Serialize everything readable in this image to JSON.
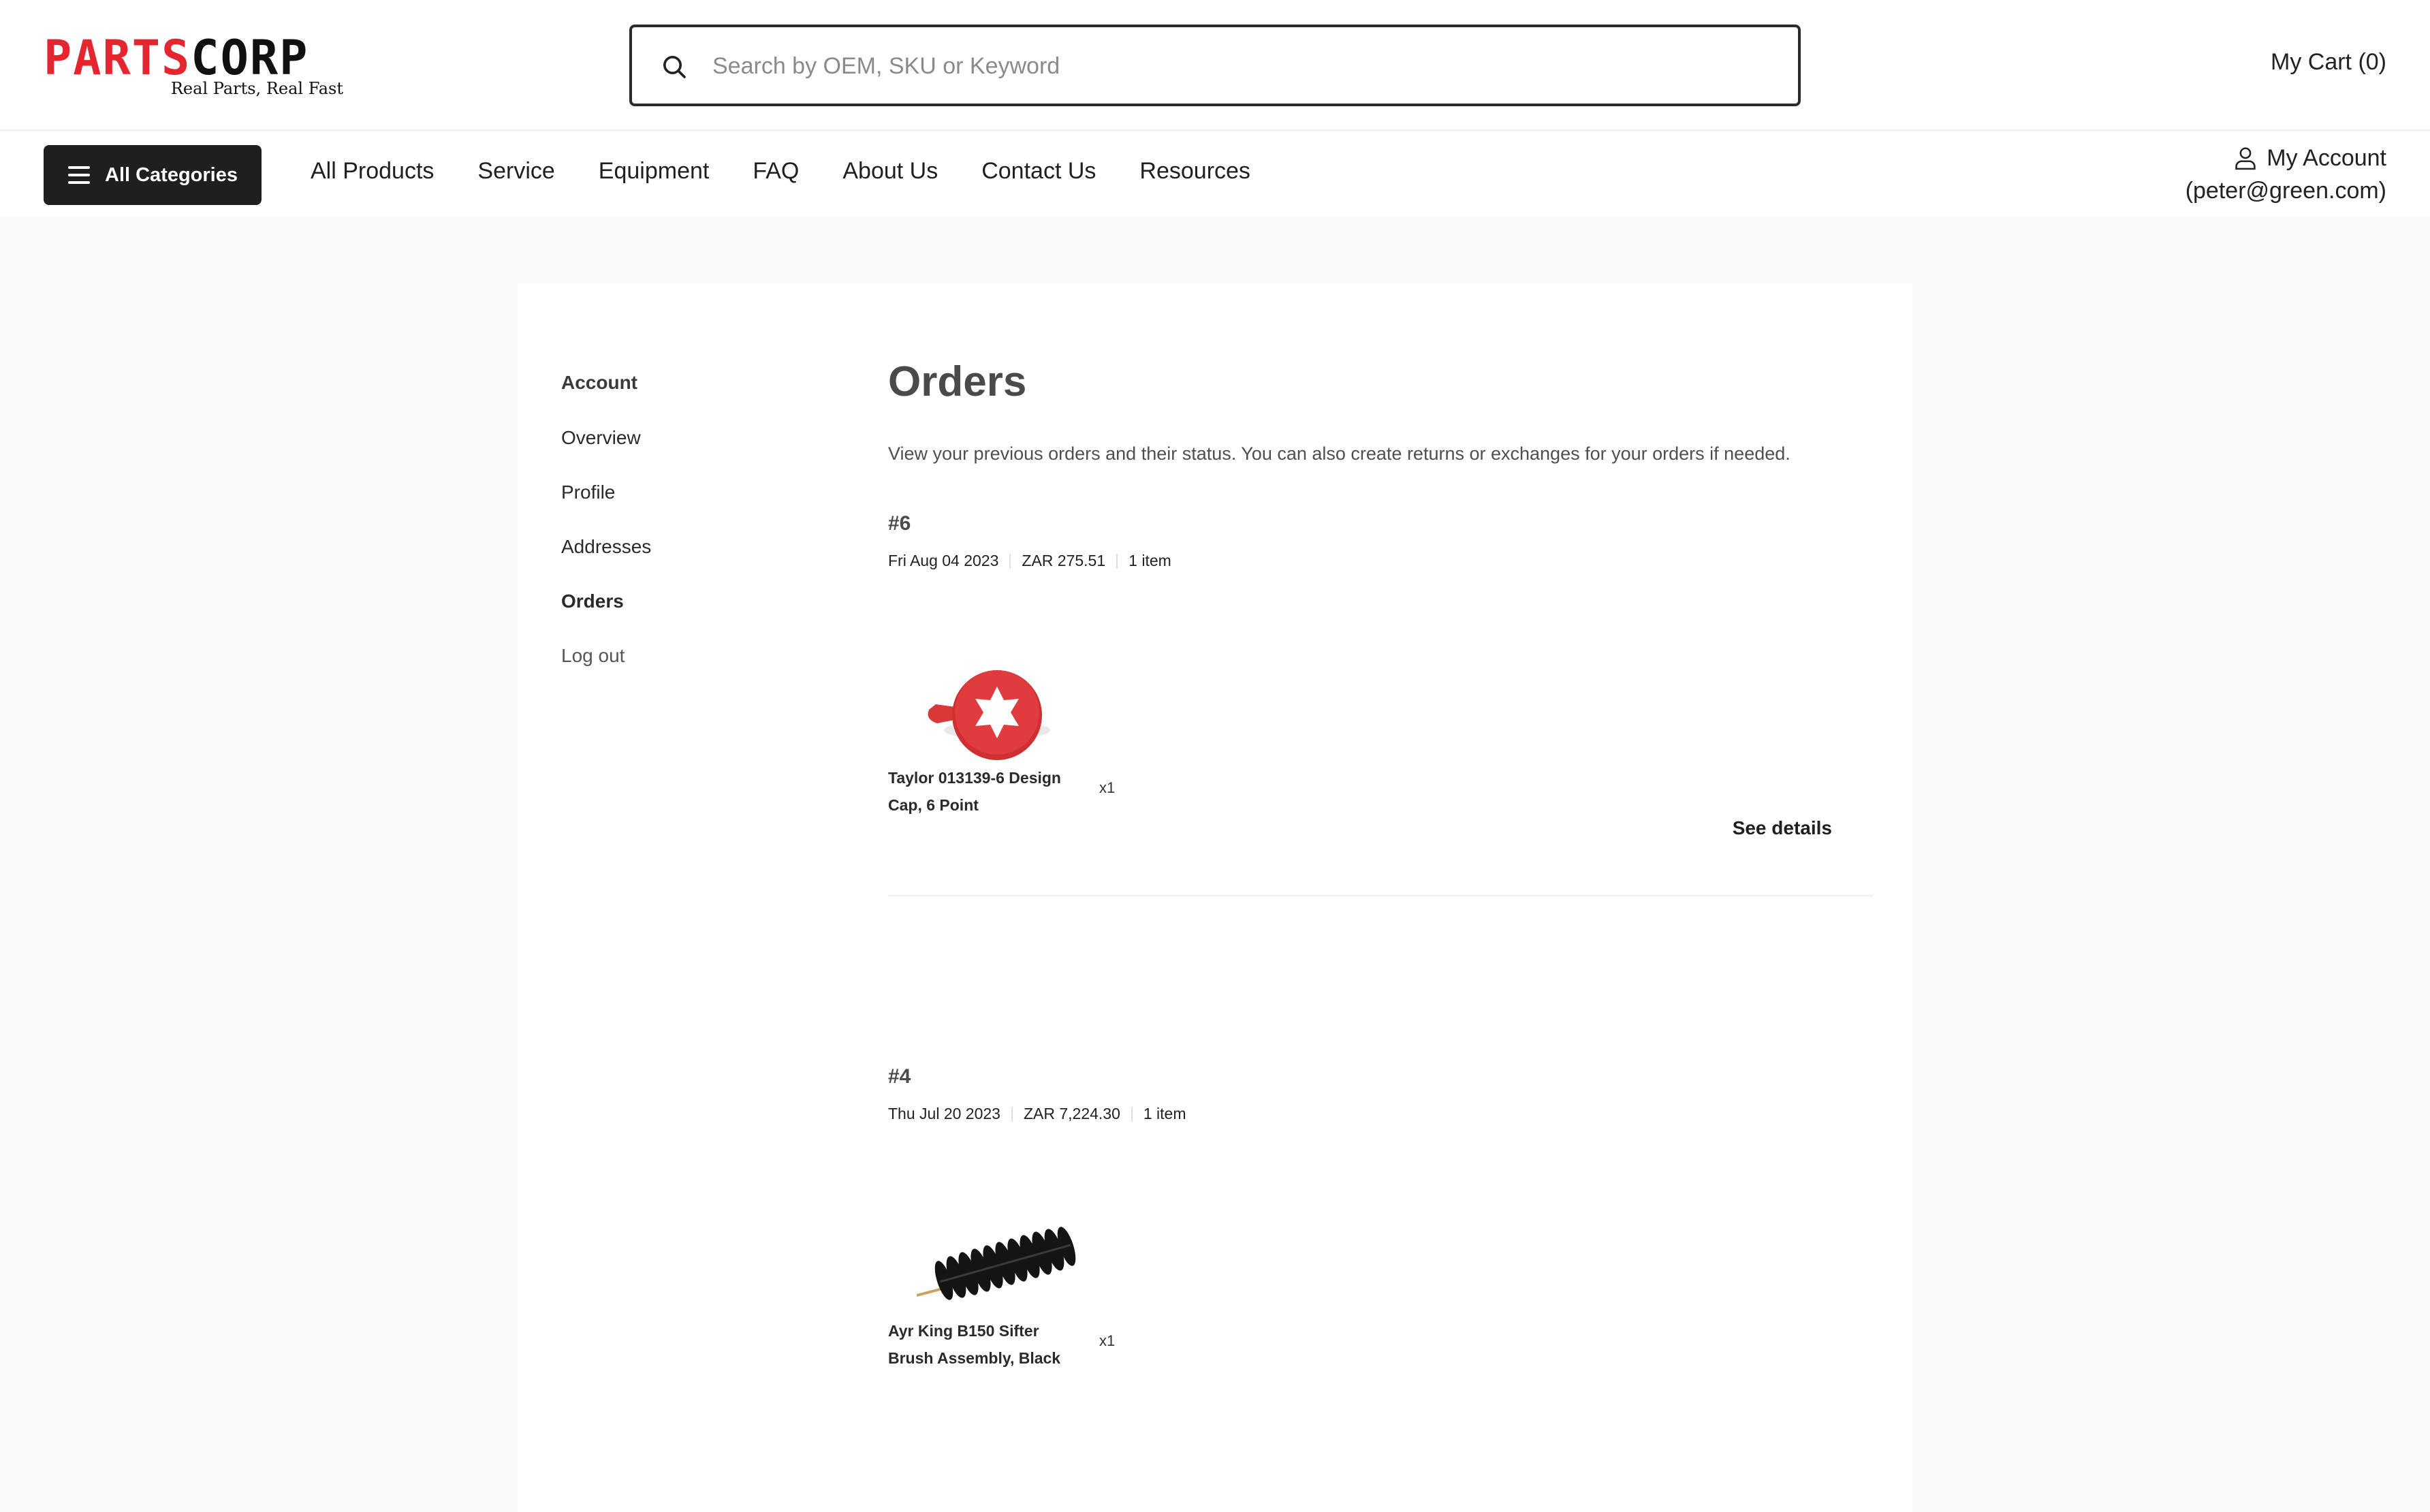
{
  "brand": {
    "name_red": "PARTS",
    "name_black": "CORP",
    "tagline": "Real Parts, Real Fast"
  },
  "search": {
    "placeholder": "Search by OEM, SKU or Keyword",
    "value": ""
  },
  "header": {
    "cart_label": "My Cart (0)"
  },
  "nav": {
    "all_categories": "All Categories",
    "links": [
      "All Products",
      "Service",
      "Equipment",
      "FAQ",
      "About Us",
      "Contact Us",
      "Resources"
    ]
  },
  "account": {
    "label": "My Account",
    "email": "(peter@green.com)"
  },
  "sidebar": {
    "title": "Account",
    "items": [
      "Overview",
      "Profile",
      "Addresses",
      "Orders",
      "Log out"
    ],
    "active": "Orders"
  },
  "page": {
    "title": "Orders",
    "description": "View your previous orders and their status. You can also create returns or exchanges for your orders if needed."
  },
  "orders": [
    {
      "id": "#6",
      "date": "Fri Aug 04 2023",
      "total": "ZAR 275.51",
      "items_count": "1 item",
      "product_line1": "Taylor 013139-6 Design",
      "product_line2": "Cap, 6 Point",
      "qty": "x1",
      "details_label": "See details",
      "thumb_icon": "red-design-cap"
    },
    {
      "id": "#4",
      "date": "Thu Jul 20 2023",
      "total": "ZAR 7,224.30",
      "items_count": "1 item",
      "product_line1": "Ayr King B150 Sifter",
      "product_line2": "Brush Assembly, Black",
      "qty": "x1",
      "thumb_icon": "black-sifter-brush"
    }
  ],
  "colors": {
    "brand_red": "#e3262f",
    "button_dark": "#1f1f1f",
    "page_bg": "#f9f9f9"
  }
}
